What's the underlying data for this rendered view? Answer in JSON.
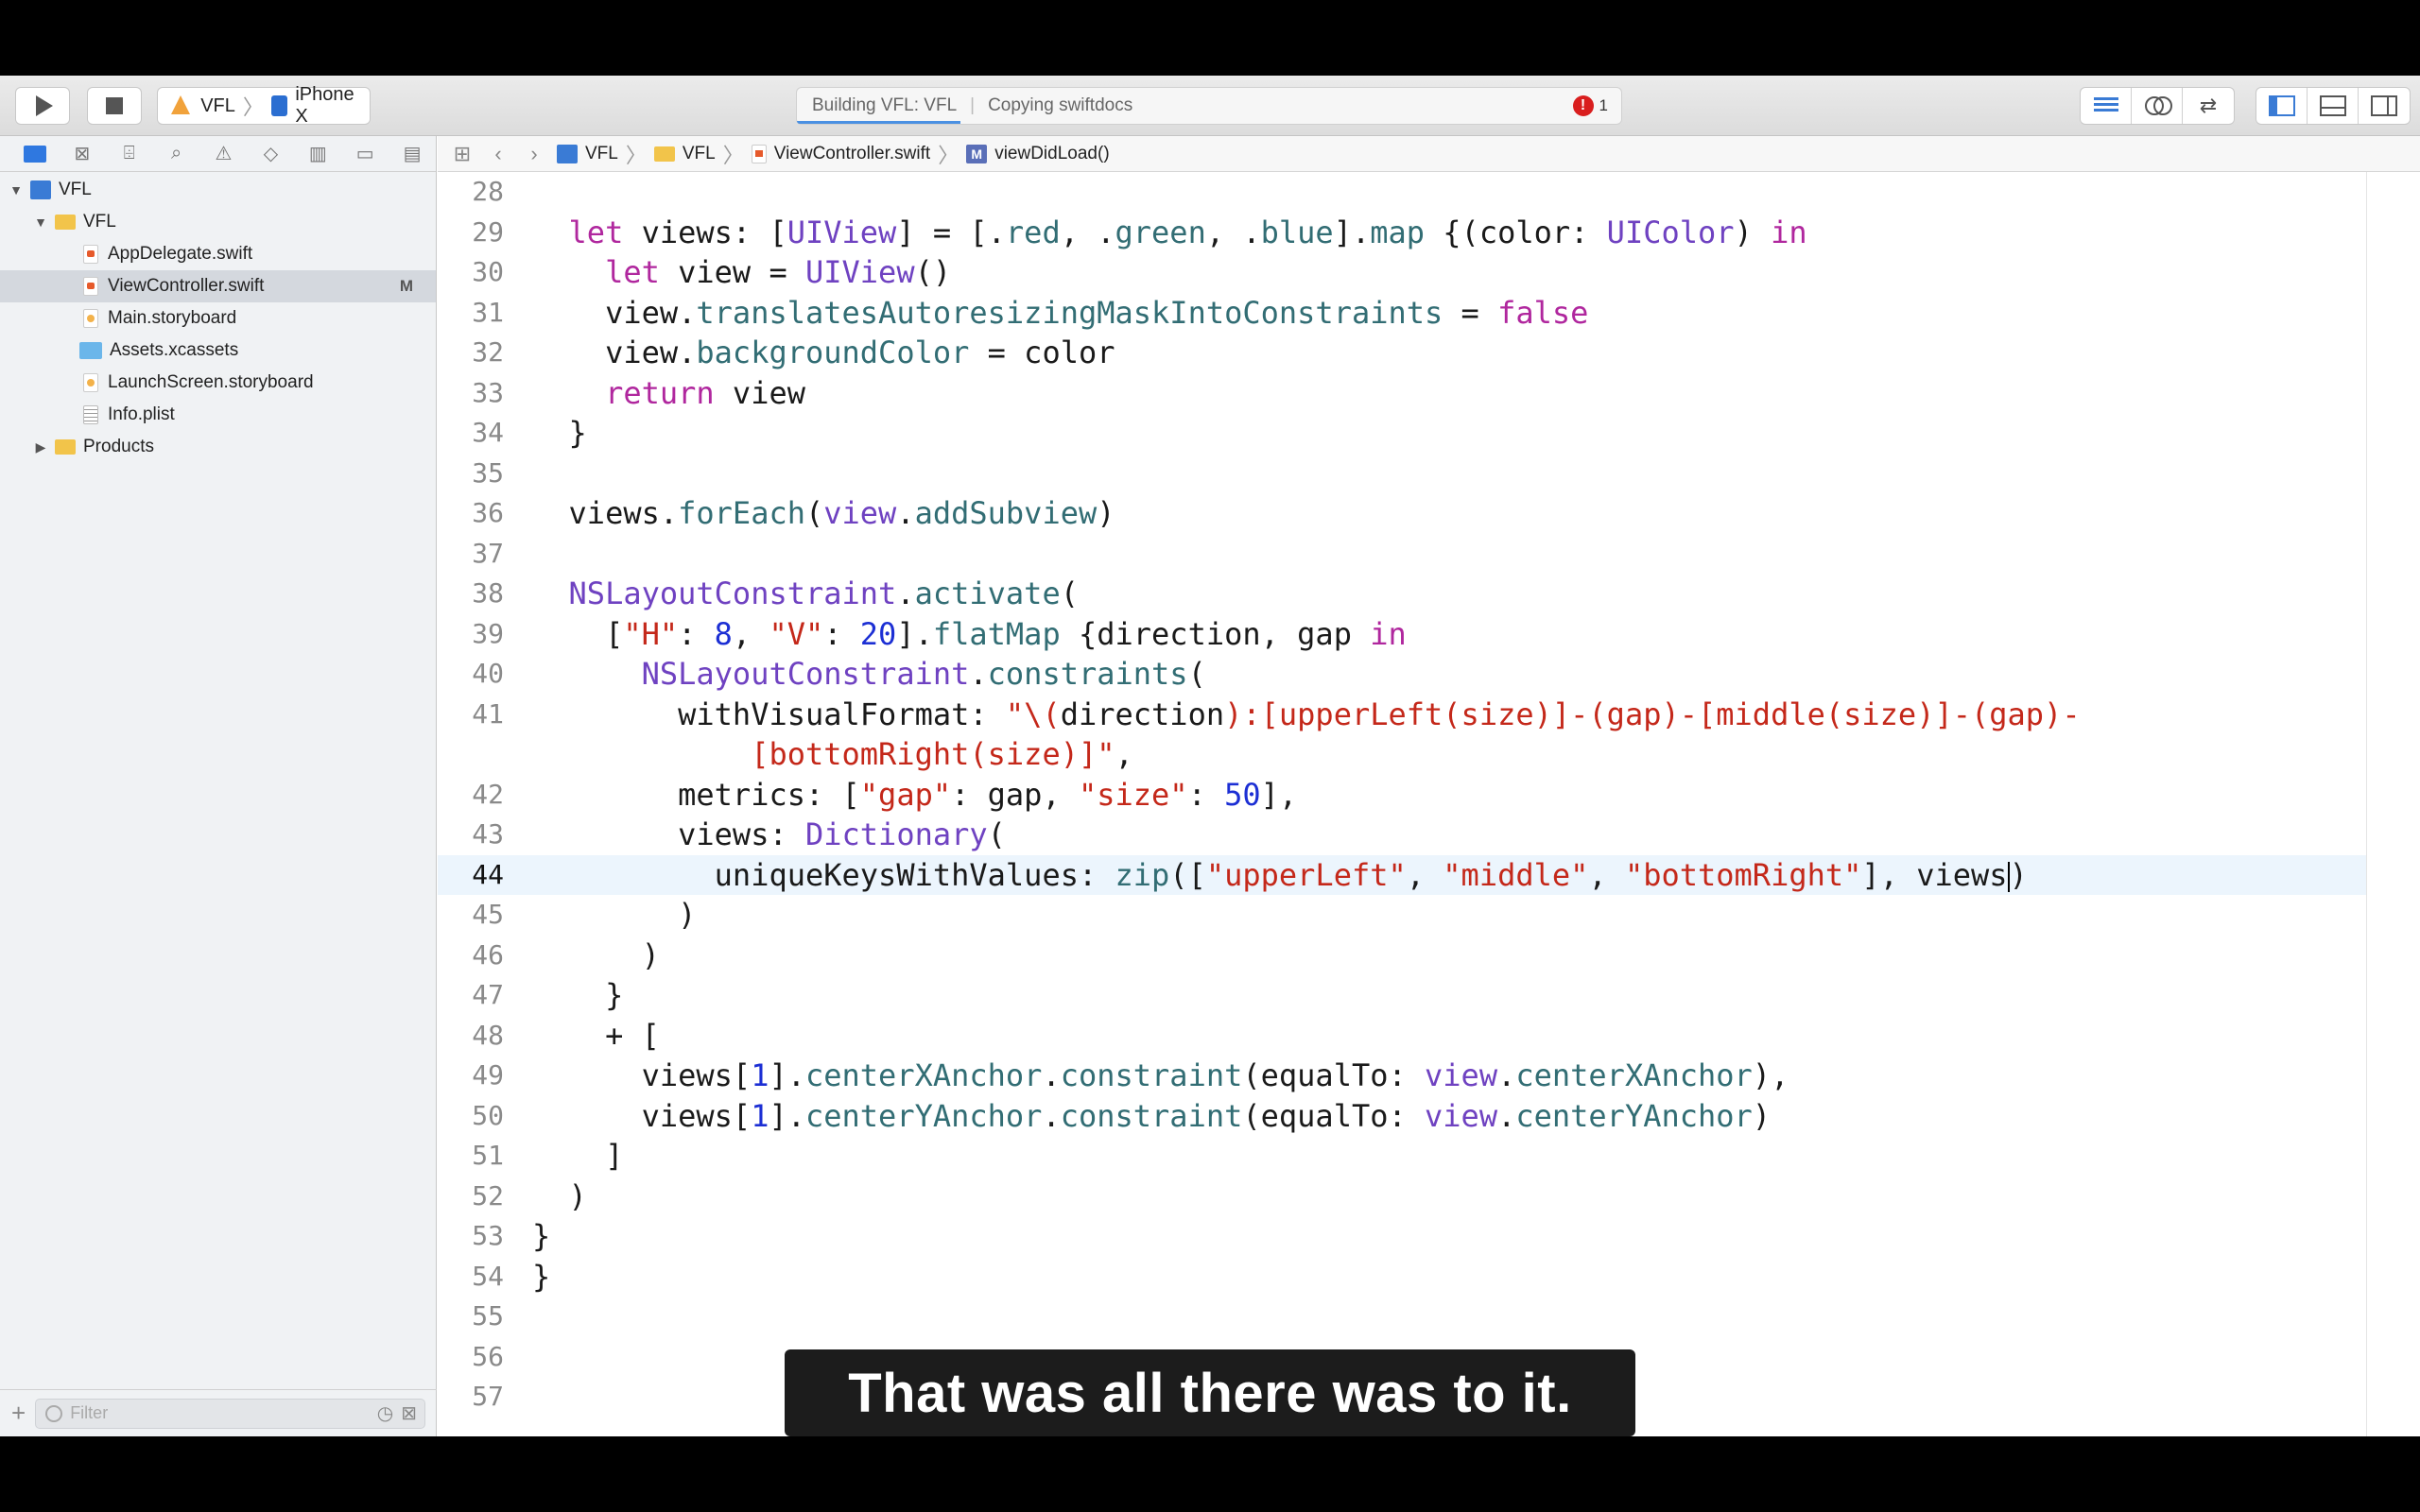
{
  "toolbar": {
    "scheme_app": "VFL",
    "scheme_device": "iPhone X",
    "activity_status": "Building VFL: VFL",
    "activity_detail": "Copying swiftdocs",
    "error_count": "1"
  },
  "navigator": {
    "filter_placeholder": "Filter",
    "items": [
      {
        "label": "VFL",
        "kind": "project",
        "depth": 0,
        "disclosure": "▼"
      },
      {
        "label": "VFL",
        "kind": "folder",
        "depth": 1,
        "disclosure": "▼"
      },
      {
        "label": "AppDelegate.swift",
        "kind": "swift",
        "depth": 2
      },
      {
        "label": "ViewController.swift",
        "kind": "swift",
        "depth": 2,
        "selected": true,
        "badge": "M"
      },
      {
        "label": "Main.storyboard",
        "kind": "storyboard",
        "depth": 2
      },
      {
        "label": "Assets.xcassets",
        "kind": "assets",
        "depth": 2
      },
      {
        "label": "LaunchScreen.storyboard",
        "kind": "storyboard",
        "depth": 2
      },
      {
        "label": "Info.plist",
        "kind": "plist",
        "depth": 2
      },
      {
        "label": "Products",
        "kind": "folder",
        "depth": 1,
        "disclosure": "▶"
      }
    ]
  },
  "jumpbar": {
    "crumbs": [
      "VFL",
      "VFL",
      "ViewController.swift",
      "viewDidLoad()"
    ]
  },
  "editor": {
    "current_line": "44",
    "lines": [
      {
        "n": "28",
        "html": ""
      },
      {
        "n": "29",
        "html": "  <span class=\"k\">let</span> views: [<span class=\"t\">UIView</span>] = [.<span class=\"p\">red</span>, .<span class=\"p\">green</span>, .<span class=\"p\">blue</span>].<span class=\"p\">map</span> {(color: <span class=\"t\">UIColor</span>) <span class=\"k\">in</span>"
      },
      {
        "n": "30",
        "html": "    <span class=\"k\">let</span> view = <span class=\"t\">UIView</span>()"
      },
      {
        "n": "31",
        "html": "    view.<span class=\"p\">translatesAutoresizingMaskIntoConstraints</span> = <span class=\"k\">false</span>"
      },
      {
        "n": "32",
        "html": "    view.<span class=\"p\">backgroundColor</span> = color"
      },
      {
        "n": "33",
        "html": "    <span class=\"k\">return</span> view"
      },
      {
        "n": "34",
        "html": "  }"
      },
      {
        "n": "35",
        "html": ""
      },
      {
        "n": "36",
        "html": "  views.<span class=\"p\">forEach</span>(<span class=\"t\">view</span>.<span class=\"p\">addSubview</span>)"
      },
      {
        "n": "37",
        "html": ""
      },
      {
        "n": "38",
        "html": "  <span class=\"t\">NSLayoutConstraint</span>.<span class=\"p\">activate</span>("
      },
      {
        "n": "39",
        "html": "    [<span class=\"s\">\"H\"</span>: <span class=\"n\">8</span>, <span class=\"s\">\"V\"</span>: <span class=\"n\">20</span>].<span class=\"p\">flatMap</span> {direction, gap <span class=\"k\">in</span>"
      },
      {
        "n": "40",
        "html": "      <span class=\"t\">NSLayoutConstraint</span>.<span class=\"p\">constraints</span>("
      },
      {
        "n": "41",
        "html": "        withVisualFormat: <span class=\"s\">\"\\(</span>direction<span class=\"s\">):[upperLeft(size)]-(gap)-[middle(size)]-(gap)-</span>"
      },
      {
        "n": "",
        "html": "            <span class=\"s\">[bottomRight(size)]\"</span>,"
      },
      {
        "n": "42",
        "html": "        metrics: [<span class=\"s\">\"gap\"</span>: gap, <span class=\"s\">\"size\"</span>: <span class=\"n\">50</span>],"
      },
      {
        "n": "43",
        "html": "        views: <span class=\"t\">Dictionary</span>("
      },
      {
        "n": "44",
        "html": "          uniqueKeysWithValues: <span class=\"p\">zip</span>([<span class=\"s\">\"upperLeft\"</span>, <span class=\"s\">\"middle\"</span>, <span class=\"s\">\"bottomRight\"</span>], views<span class=\"cursor\"></span>)"
      },
      {
        "n": "45",
        "html": "        )"
      },
      {
        "n": "46",
        "html": "      )"
      },
      {
        "n": "47",
        "html": "    }"
      },
      {
        "n": "48",
        "html": "    + ["
      },
      {
        "n": "49",
        "html": "      views[<span class=\"n\">1</span>].<span class=\"p\">centerXAnchor</span>.<span class=\"p\">constraint</span>(equalTo: <span class=\"t\">view</span>.<span class=\"p\">centerXAnchor</span>),"
      },
      {
        "n": "50",
        "html": "      views[<span class=\"n\">1</span>].<span class=\"p\">centerYAnchor</span>.<span class=\"p\">constraint</span>(equalTo: <span class=\"t\">view</span>.<span class=\"p\">centerYAnchor</span>)"
      },
      {
        "n": "51",
        "html": "    ]"
      },
      {
        "n": "52",
        "html": "  )"
      },
      {
        "n": "53",
        "html": "}"
      },
      {
        "n": "54",
        "html": "}"
      },
      {
        "n": "55",
        "html": ""
      },
      {
        "n": "56",
        "html": ""
      },
      {
        "n": "57",
        "html": ""
      }
    ]
  },
  "caption": "That was all there was to it."
}
